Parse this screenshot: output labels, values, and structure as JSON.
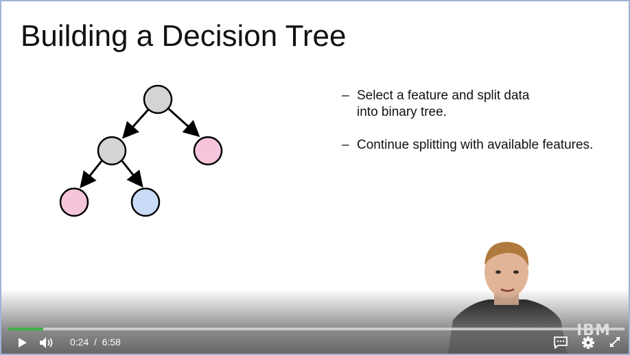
{
  "slide": {
    "title": "Building a Decision Tree",
    "bullets": [
      {
        "dash": "–",
        "text": "Select a feature and split data into binary tree."
      },
      {
        "dash": "–",
        "text": "Continue splitting with available features."
      }
    ],
    "tree_colors": {
      "internal": "#d4d4d4",
      "pink": "#f6c5dc",
      "blue": "#c9dbf7"
    }
  },
  "player": {
    "current_time": "0:24",
    "separator": "/",
    "duration": "6:58",
    "progress_percent": 5.7,
    "accent": "#3cb043",
    "logo": "IBM"
  }
}
